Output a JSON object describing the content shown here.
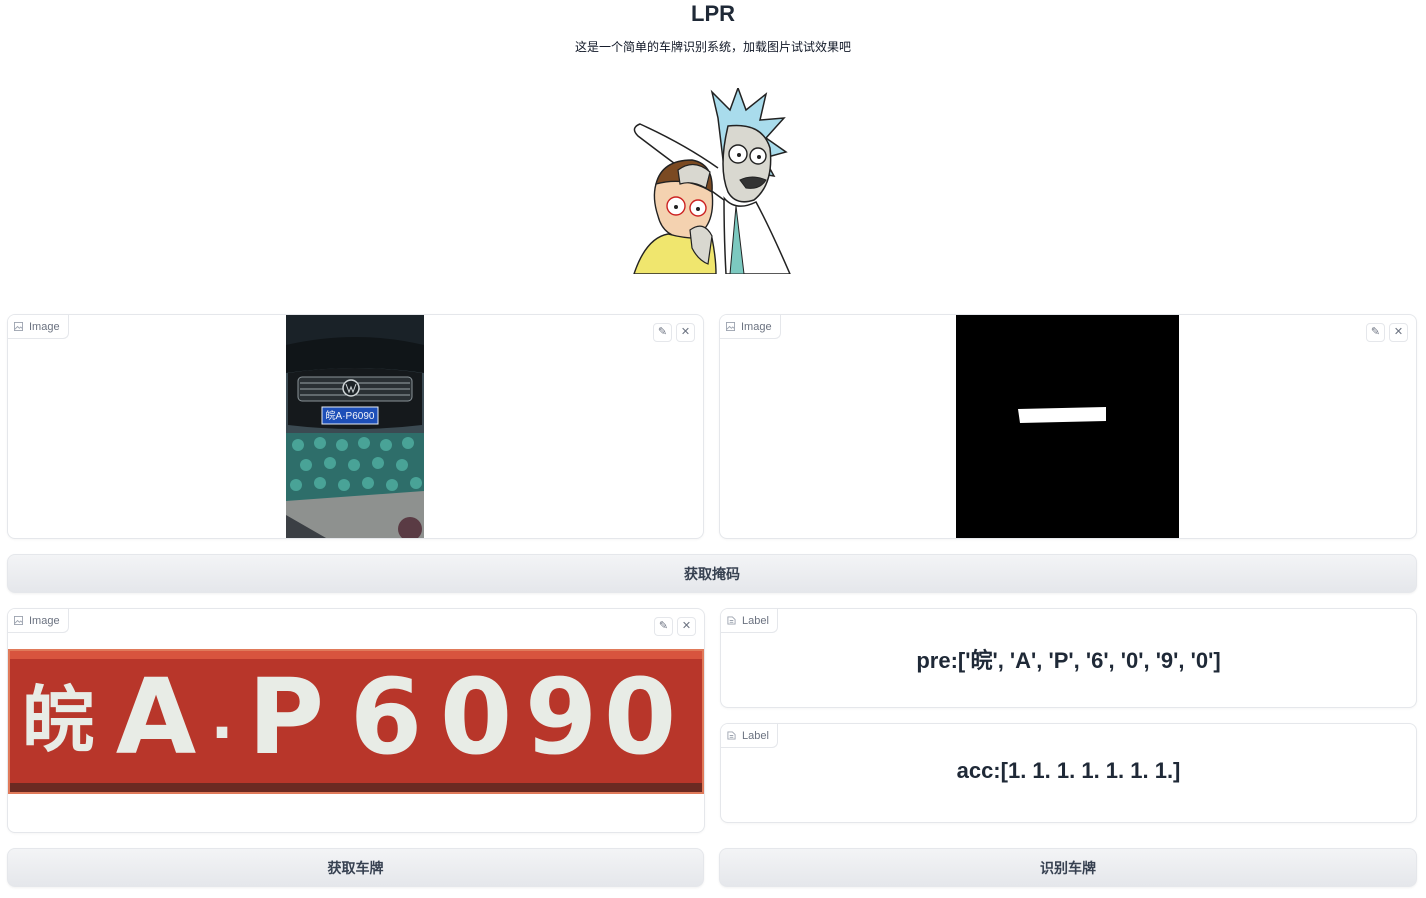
{
  "app": {
    "title": "LPR",
    "description": "这是一个简单的车牌识别系统，加载图片试试效果吧"
  },
  "input_image": {
    "label": "Image",
    "plate_text": "皖A·P6090"
  },
  "mask_image": {
    "label": "Image"
  },
  "buttons": {
    "get_mask": "获取掩码",
    "get_plate": "获取车牌",
    "recognize_plate": "识别车牌"
  },
  "plate_image": {
    "label": "Image",
    "chars": [
      "皖",
      "A",
      "·",
      "P",
      "6",
      "0",
      "9",
      "0"
    ]
  },
  "prediction": {
    "label": "Label",
    "value": "pre:['皖', 'A', 'P', '6', '0', '9', '0']"
  },
  "accuracy": {
    "label": "Label",
    "value": "acc:[1. 1. 1. 1. 1. 1. 1.]"
  },
  "colors": {
    "plate_red": "#c8341f",
    "plate_blue": "#1d4fb8",
    "block_border": "#e5e7eb",
    "button_bg": "#e5e7eb"
  }
}
